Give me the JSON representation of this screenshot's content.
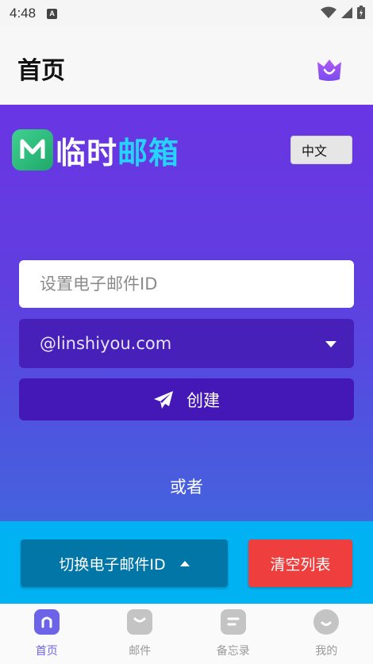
{
  "status_bar": {
    "time": "4:48",
    "notif_letter": "A"
  },
  "header": {
    "title": "首页"
  },
  "logo": {
    "part1": "临时",
    "part2": "邮箱"
  },
  "lang_button": "中文",
  "id_input": {
    "placeholder": "设置电子邮件ID",
    "value": ""
  },
  "domain_select": {
    "selected": "@linshiyou.com"
  },
  "create_button": {
    "label": "创建"
  },
  "or_text": "或者",
  "actions": {
    "switch_label": "切换电子邮件ID",
    "clear_label": "清空列表"
  },
  "tabs": [
    {
      "label": "首页",
      "icon": "home-icon",
      "active": true
    },
    {
      "label": "邮件",
      "icon": "mail-icon",
      "active": false
    },
    {
      "label": "备忘录",
      "icon": "memo-icon",
      "active": false
    },
    {
      "label": "我的",
      "icon": "profile-icon",
      "active": false
    }
  ],
  "colors": {
    "accent": "#6c63e8",
    "hero_top": "#6a35e3",
    "action_bar": "#00b2f2",
    "clear": "#ef3e3e"
  }
}
